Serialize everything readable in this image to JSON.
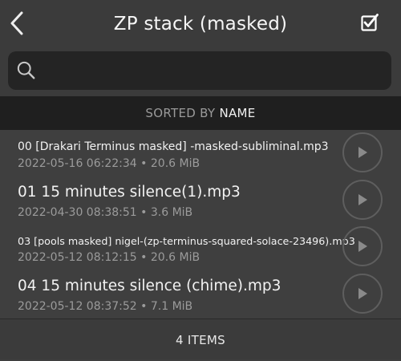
{
  "header": {
    "title": "ZP stack (masked)",
    "back_icon": "chevron-left-icon",
    "select_icon": "checkbox-checked-icon"
  },
  "search": {
    "placeholder": "",
    "value": "",
    "icon": "search-icon"
  },
  "sort": {
    "prefix": "SORTED BY",
    "value": "NAME"
  },
  "files": [
    {
      "name": "00 [Drakari Terminus masked] -masked-subliminal.mp3",
      "date": "2022-05-16 06:22:34",
      "separator": "•",
      "size": "20.6 MiB"
    },
    {
      "name": "01 15 minutes silence(1).mp3",
      "date": "2022-04-30 08:38:51",
      "separator": "•",
      "size": "3.6 MiB"
    },
    {
      "name": "03 [pools masked] nigel-(zp-terminus-squared-solace-23496).mp3",
      "date": "2022-05-12 08:12:15",
      "separator": "•",
      "size": "20.6 MiB"
    },
    {
      "name": "04 15 minutes silence (chime).mp3",
      "date": "2022-05-12 08:37:52",
      "separator": "•",
      "size": "7.1 MiB"
    }
  ],
  "footer": {
    "item_count": "4 ITEMS"
  },
  "colors": {
    "background": "#3f3f3f",
    "header": "#3b3b3b",
    "search_field": "#242424",
    "sort_bar": "#1f1f1f",
    "secondary_text": "#9b9b9b"
  }
}
